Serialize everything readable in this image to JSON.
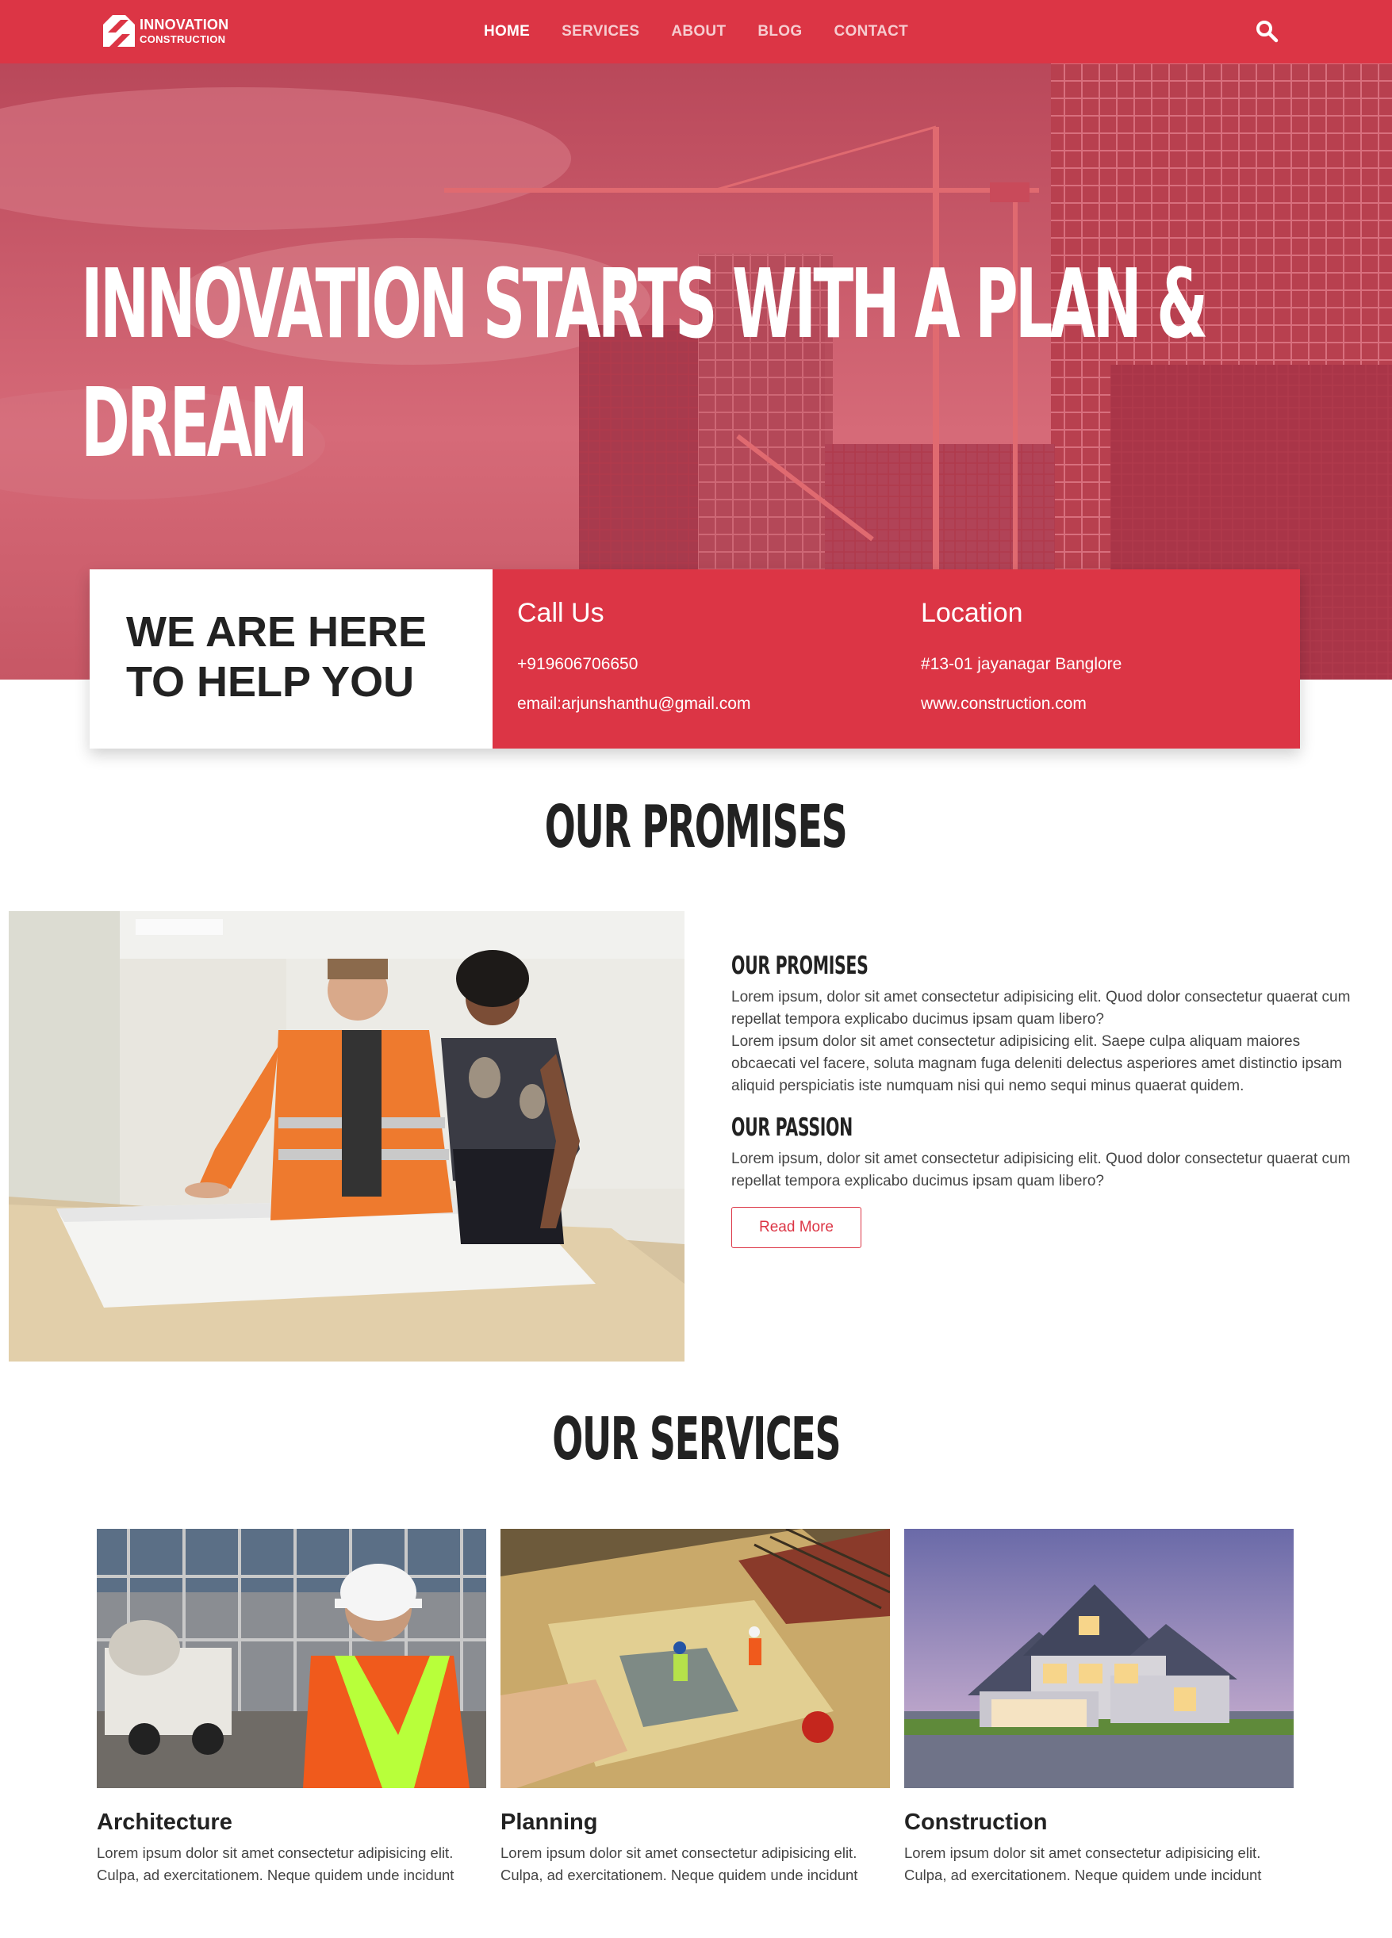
{
  "brand": {
    "name_line1": "INNOVATION",
    "name_line2": "CONSTRUCTION"
  },
  "nav": {
    "items": [
      {
        "label": "HOME",
        "active": true
      },
      {
        "label": "SERVICES",
        "active": false
      },
      {
        "label": "ABOUT",
        "active": false
      },
      {
        "label": "BLOG",
        "active": false
      },
      {
        "label": "CONTACT",
        "active": false
      }
    ],
    "search_icon": "search-icon"
  },
  "hero": {
    "title_line1": "INNOVATION STARTS WITH A PLAN &",
    "title_line2": "DREAM"
  },
  "help": {
    "heading_line1": "WE ARE HERE",
    "heading_line2": "TO HELP YOU",
    "call": {
      "title": "Call Us",
      "phone": "+919606706650",
      "email": "email:arjunshanthu@gmail.com"
    },
    "location": {
      "title": "Location",
      "address": "#13-01 jayanagar Banglore",
      "website": "www.construction.com"
    }
  },
  "promises": {
    "section_title": "OUR PROMISES",
    "sub1": "OUR PROMISES",
    "p1a": "Lorem ipsum, dolor sit amet consectetur adipisicing elit. Quod dolor consectetur quaerat cum repellat tempora explicabo ducimus ipsam quam libero?",
    "p1b": "Lorem ipsum dolor sit amet consectetur adipisicing elit. Saepe culpa aliquam maiores obcaecati vel facere, soluta magnam fuga deleniti delectus asperiores amet distinctio ipsam aliquid perspiciatis iste numquam nisi qui nemo sequi minus quaerat quidem.",
    "sub2": "OUR PASSION",
    "p2": "Lorem ipsum, dolor sit amet consectetur adipisicing elit. Quod dolor consectetur quaerat cum repellat tempora explicabo ducimus ipsam quam libero?",
    "button": "Read More"
  },
  "services": {
    "section_title": "OUR SERVICES",
    "items": [
      {
        "title": "Architecture",
        "line1": "Lorem ipsum dolor sit amet consectetur adipisicing elit.",
        "line2": "Culpa, ad exercitationem. Neque quidem unde incidunt"
      },
      {
        "title": "Planning",
        "line1": "Lorem ipsum dolor sit amet consectetur adipisicing elit.",
        "line2": "Culpa, ad exercitationem. Neque quidem unde incidunt"
      },
      {
        "title": "Construction",
        "line1": "Lorem ipsum dolor sit amet consectetur adipisicing elit.",
        "line2": "Culpa, ad exercitationem. Neque quidem unde incidunt"
      }
    ]
  },
  "colors": {
    "brand_red": "#dc3545",
    "text_dark": "#222222",
    "text_body": "#444444"
  }
}
